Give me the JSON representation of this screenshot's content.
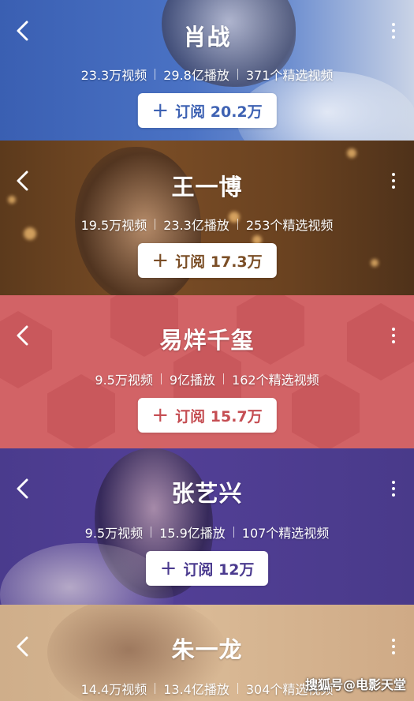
{
  "channels": [
    {
      "name": "肖战",
      "videos": "23.3万视频",
      "plays": "29.8亿播放",
      "featured": "371个精选视频",
      "subscribe_label": "订阅 20.2万",
      "accent": "#3e62b3"
    },
    {
      "name": "王一博",
      "videos": "19.5万视频",
      "plays": "23.3亿播放",
      "featured": "253个精选视频",
      "subscribe_label": "订阅 17.3万",
      "accent": "#7b4e26"
    },
    {
      "name": "易烊千玺",
      "videos": "9.5万视频",
      "plays": "9亿播放",
      "featured": "162个精选视频",
      "subscribe_label": "订阅 15.7万",
      "accent": "#c54e53"
    },
    {
      "name": "张艺兴",
      "videos": "9.5万视频",
      "plays": "15.9亿播放",
      "featured": "107个精选视频",
      "subscribe_label": "订阅 12万",
      "accent": "#4b3b8f"
    },
    {
      "name": "朱一龙",
      "videos": "14.4万视频",
      "plays": "13.4亿播放",
      "featured": "304个精选视频"
    }
  ],
  "icons": {
    "back": "chevron-left-icon",
    "more": "more-vertical-icon",
    "plus": "plus-icon"
  },
  "watermark": {
    "text": "搜狐号@电影天堂"
  }
}
